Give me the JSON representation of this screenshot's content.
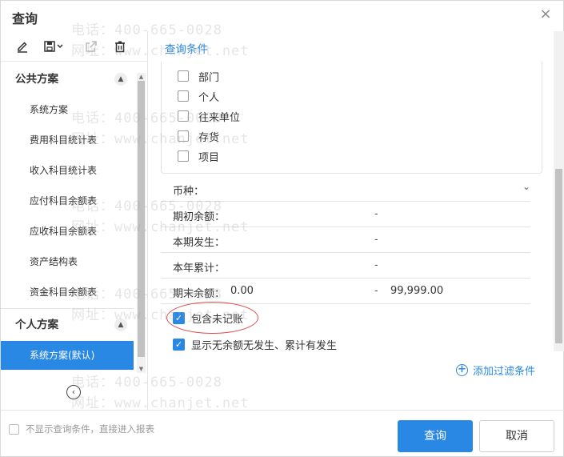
{
  "window": {
    "title": "查询",
    "close_symbol": "×"
  },
  "toolbar": {
    "items": [
      "edit",
      "save",
      "export",
      "delete"
    ]
  },
  "sidebar": {
    "public_group": "公共方案",
    "public_items": [
      "系统方案",
      "费用科目统计表",
      "收入科目统计表",
      "应付科目余额表",
      "应收科目余额表",
      "资产结构表",
      "资金科目余额表"
    ],
    "personal_group": "个人方案",
    "personal_items": [
      "系统方案(默认)"
    ]
  },
  "conditions": {
    "title": "查询条件",
    "dimensions": [
      "部门",
      "个人",
      "往来单位",
      "存货",
      "项目"
    ],
    "currency_label": "币种：",
    "opening_balance_label": "期初余额：",
    "current_period_label": "本期发生：",
    "year_total_label": "本年累计：",
    "closing_balance_label": "期末余额：",
    "closing_from": "0.00",
    "closing_to": "99,999.00",
    "dash": "-",
    "include_unposted": "包含未记账",
    "show_no_balance": "显示无余额无发生、累计有发生",
    "add_filter": "添加过滤条件"
  },
  "footer": {
    "skip_label": "不显示查询条件，直接进入报表",
    "query_button": "查询",
    "cancel_button": "取消"
  },
  "watermark": {
    "phone": "电话：400-665-0028",
    "site": "网址：www.chanjet.net"
  },
  "colors": {
    "accent": "#2a88e5",
    "highlight": "#e04a4a"
  }
}
